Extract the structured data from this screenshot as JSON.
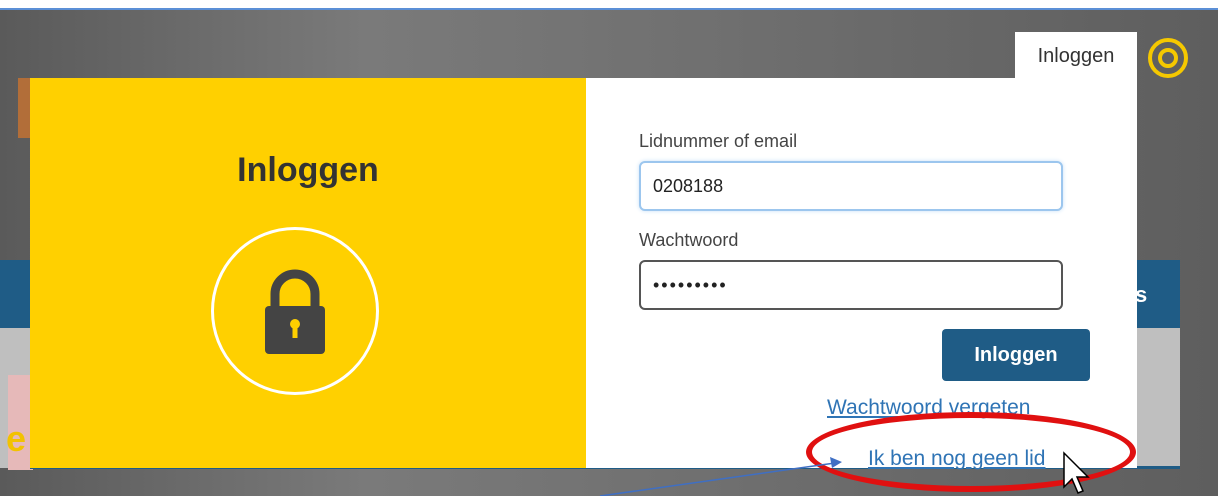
{
  "header": {
    "tab_label": "Inloggen",
    "logo_icon": "circle-logo-icon"
  },
  "background": {
    "band_text": "s",
    "partial_text": "e"
  },
  "login_modal": {
    "title": "Inloggen",
    "lock_icon": "lock-icon",
    "email_label": "Lidnummer of email",
    "email_value": "0208188",
    "password_label": "Wachtwoord",
    "password_value": "•••••••••",
    "submit_label": "Inloggen",
    "forgot_link": "Wachtwoord vergeten",
    "not_member_link": "Ik ben nog geen lid"
  },
  "colors": {
    "accent_yellow": "#ffd000",
    "primary_blue": "#1f5c86",
    "link_blue": "#2f74b5",
    "highlight_red": "#e01010"
  }
}
